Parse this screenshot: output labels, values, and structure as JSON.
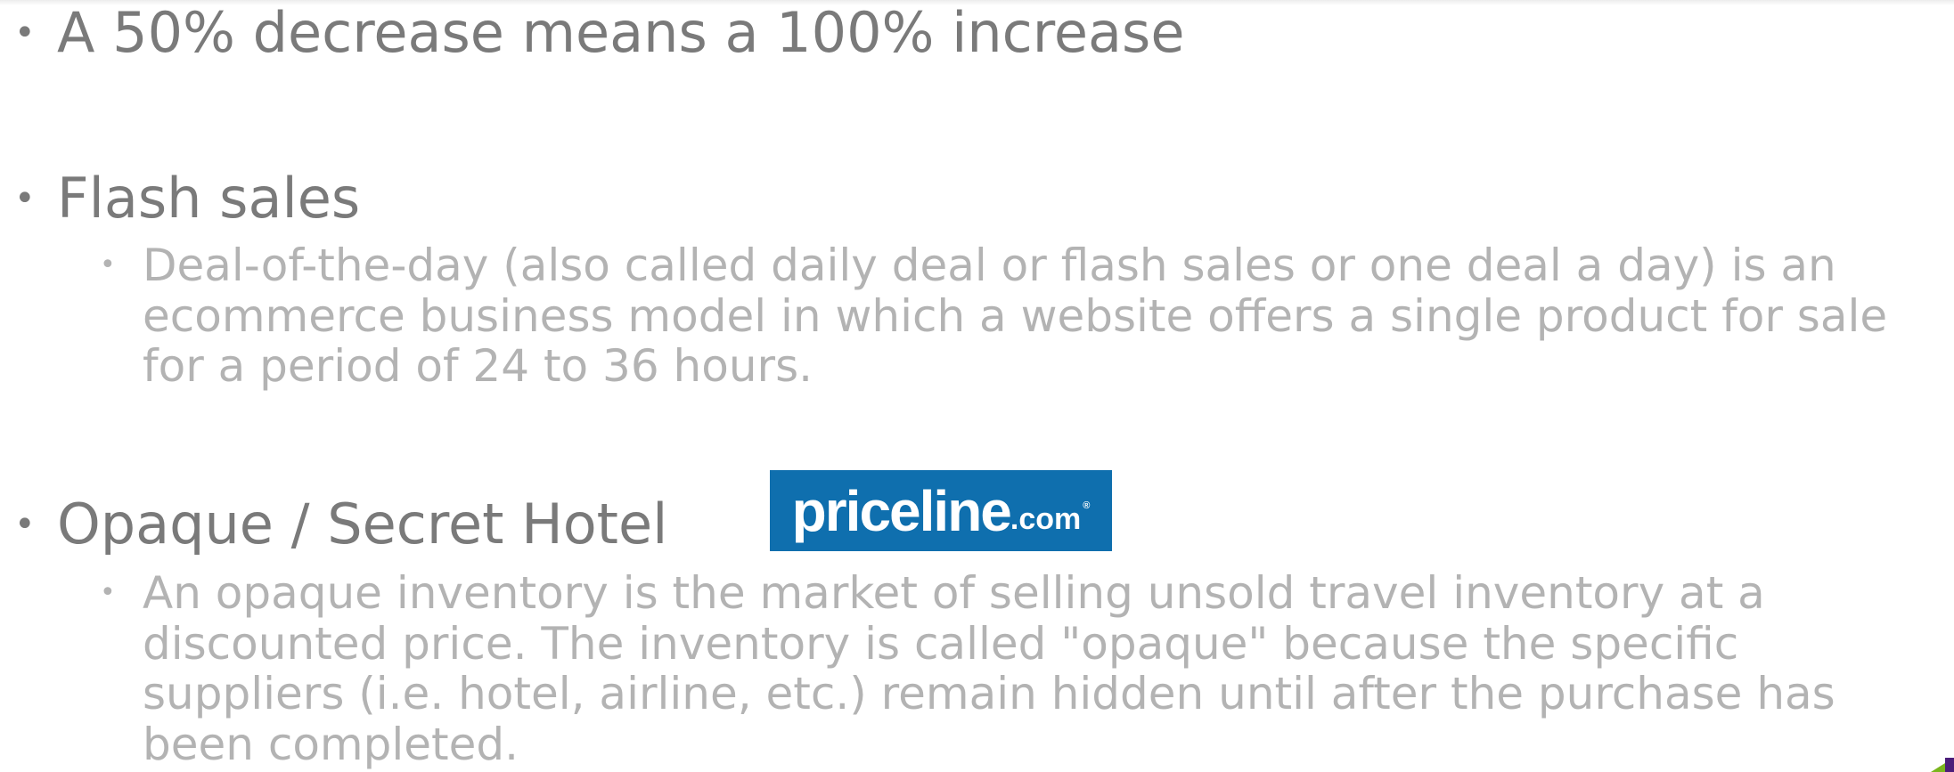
{
  "bullets": [
    {
      "text": "A 50% decrease means a 100% increase"
    },
    {
      "text": "Flash sales",
      "sub_lines": [
        "Deal-of-the-day (also called daily deal or flash sales or one deal a day) is an",
        "ecommerce business model in which a website offers a single product for sale",
        "for a period of 24 to 36 hours."
      ]
    },
    {
      "text": "Opaque / Secret Hotel",
      "sub_lines": [
        "An opaque inventory is the market of selling unsold travel inventory at a",
        "discounted price. The inventory is called \"opaque\" because the specific",
        "suppliers (i.e. hotel, airline, etc.) remain hidden until after the purchase has",
        "been completed."
      ]
    }
  ],
  "logo": {
    "main": "priceline",
    "suffix": ".com",
    "mark": "®",
    "color": "#0f6fae"
  },
  "bullet_glyph": "•"
}
